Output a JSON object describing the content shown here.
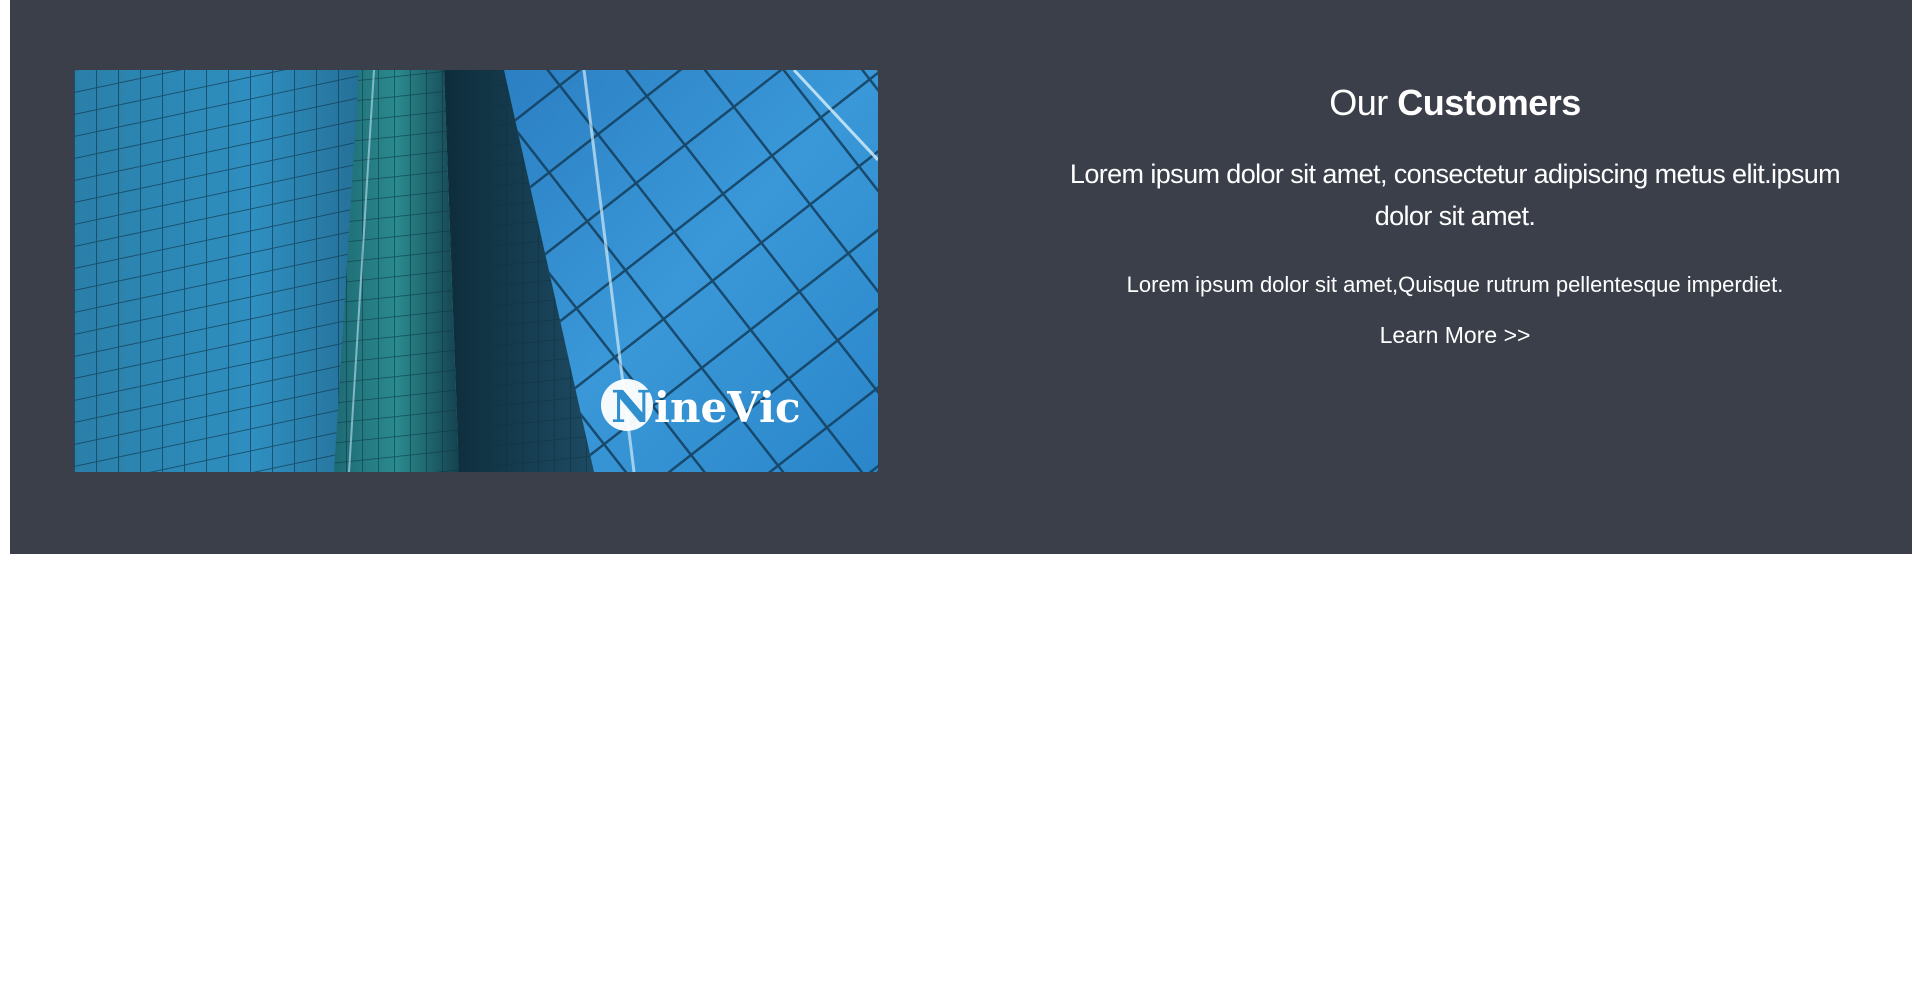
{
  "feature": {
    "heading_prefix": "Our",
    "heading_emphasis": "Customers",
    "lead": "Lorem ipsum dolor sit amet, consectetur adipiscing metus elit.ipsum dolor sit amet.",
    "body": "Lorem ipsum dolor sit amet,Quisque rutrum pellentesque imperdiet.",
    "link_label": "Learn More >>"
  },
  "image": {
    "subject": "glass-office-towers",
    "watermark": "NineVic"
  },
  "colors": {
    "band_background": "#3a3f4a",
    "text": "#ffffff",
    "page_background": "#ffffff",
    "glass_blue": "#2f8fcf"
  }
}
